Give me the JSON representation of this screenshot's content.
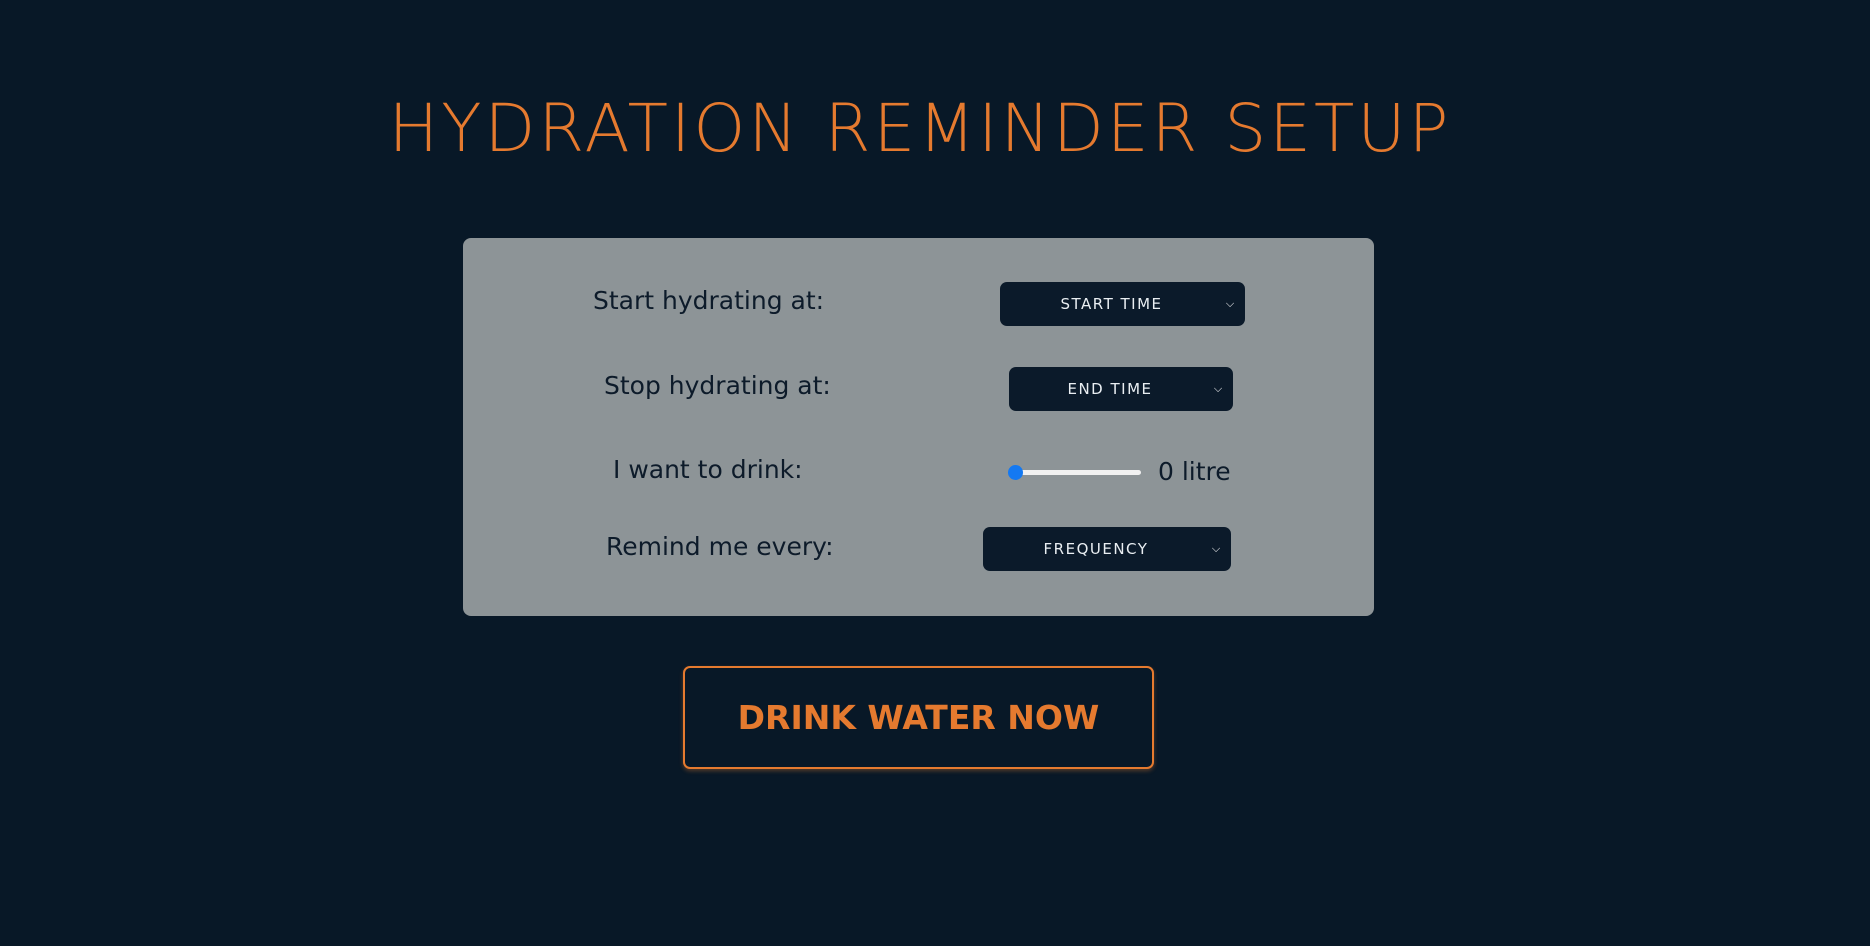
{
  "header": {
    "title": "HYDRATION REMINDER SETUP"
  },
  "colors": {
    "background": "#081827",
    "accent": "#e57a2f",
    "panel": "#8d9497",
    "control": "#0b1a2a",
    "slider_accent": "#1479f2"
  },
  "form": {
    "start": {
      "label": "Start hydrating at:",
      "select_value": "START TIME",
      "icon": "chevron-down-icon"
    },
    "stop": {
      "label": "Stop hydrating at:",
      "select_value": "END TIME",
      "icon": "chevron-down-icon"
    },
    "amount": {
      "label": "I want to drink:",
      "slider_fraction": 0,
      "readout": "0 litre"
    },
    "frequency": {
      "label": "Remind me every:",
      "select_value": "FREQUENCY",
      "icon": "chevron-down-icon"
    }
  },
  "action": {
    "label": "DRINK WATER NOW"
  }
}
